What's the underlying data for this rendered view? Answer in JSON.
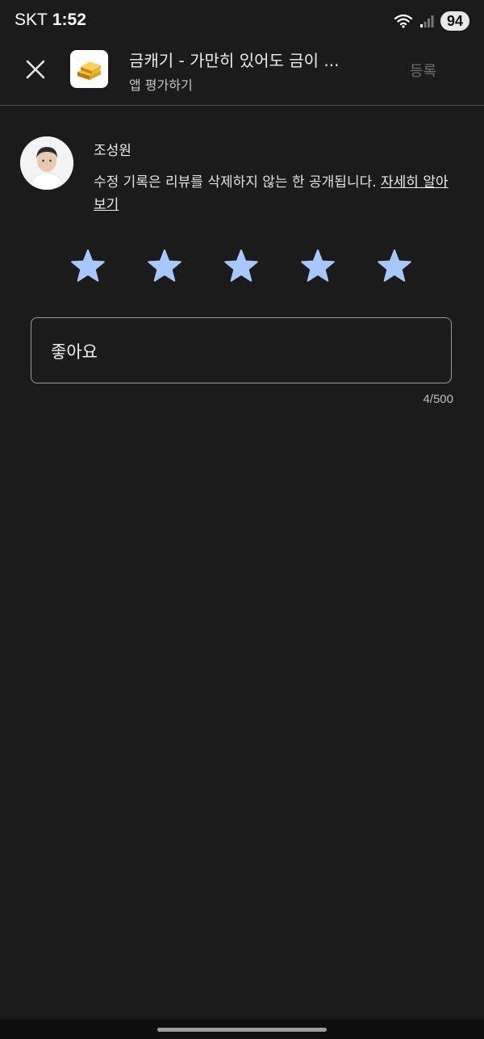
{
  "status_bar": {
    "carrier": "SKT",
    "time": "1:52",
    "battery": "94"
  },
  "header": {
    "app_title": "금캐기 - 가만히 있어도 금이 ...",
    "subtitle": "앱 평가하기",
    "submit_label": "등록"
  },
  "user": {
    "name": "조성원",
    "notice": "수정 기록은 리뷰를 삭제하지 않는 한 공개됩니다. ",
    "learn_more": "자세히 알아보기"
  },
  "rating": {
    "value": 5,
    "max": 5,
    "star_color": "#a8c7fa"
  },
  "review": {
    "text": "좋아요",
    "counter": "4/500"
  }
}
